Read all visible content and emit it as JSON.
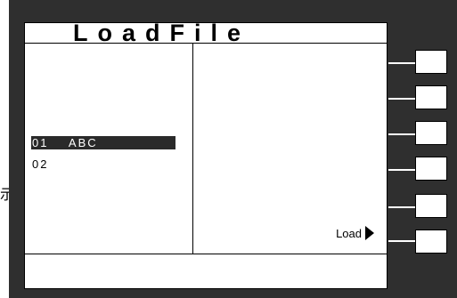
{
  "title": "LoadFile",
  "files": [
    {
      "num": "01",
      "name": "ABC",
      "selected": true
    },
    {
      "num": "02",
      "name": "",
      "selected": false
    }
  ],
  "load_label": "Load",
  "edge_glyph": "示",
  "colors": {
    "bezel": "#2f2f2f",
    "screen": "#ffffff",
    "selection": "#2a2a2a"
  }
}
